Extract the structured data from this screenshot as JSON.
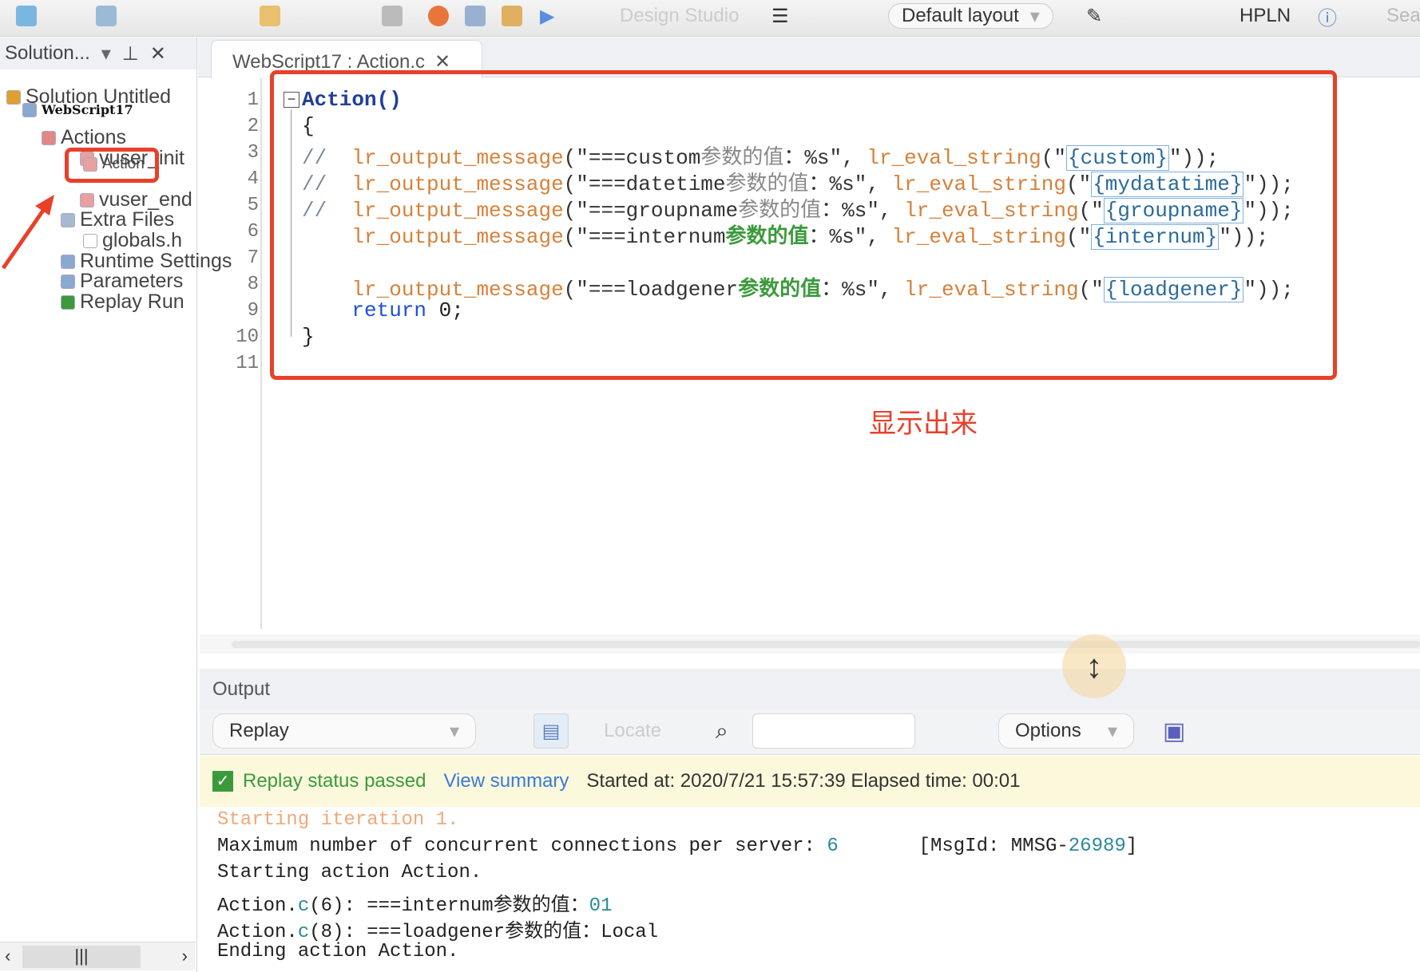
{
  "toolbar": {
    "design_studio": "Design Studio",
    "layout": "Default layout",
    "hpln": "HPLN",
    "search": "Sea"
  },
  "solution": {
    "title": "Solution...",
    "items": [
      {
        "label": "Solution Untitled",
        "icon": "solution-icon"
      },
      {
        "label": "WebScript17",
        "icon": "script-icon"
      },
      {
        "label": "Actions",
        "icon": "actions-icon"
      },
      {
        "label": "vuser_init",
        "icon": "action-icon"
      },
      {
        "label": "Action",
        "icon": "action-icon"
      },
      {
        "label": "vuser_end",
        "icon": "action-icon"
      },
      {
        "label": "Extra Files",
        "icon": "files-icon"
      },
      {
        "label": "globals.h",
        "icon": "file-icon"
      },
      {
        "label": "Runtime Settings",
        "icon": "runtime-icon"
      },
      {
        "label": "Parameters",
        "icon": "parameters-icon"
      },
      {
        "label": "Replay Run",
        "icon": "check-icon"
      }
    ]
  },
  "editor": {
    "tab": "WebScript17 : Action.c",
    "lines": [
      [
        {
          "t": "Action()",
          "c": "fold"
        }
      ],
      [
        {
          "t": "{",
          "c": ""
        }
      ],
      [
        {
          "t": "//  ",
          "c": "cm"
        },
        {
          "t": "lr_output_message",
          "c": "fn"
        },
        {
          "t": "(\"===custom",
          "c": "str"
        },
        {
          "t": "参数的值",
          "c": "zhc"
        },
        {
          "t": "：%s\", ",
          "c": "str"
        },
        {
          "t": "lr_eval_string",
          "c": "fn"
        },
        {
          "t": "(\"",
          "c": "str"
        },
        {
          "t": "{custom}",
          "c": "prm"
        },
        {
          "t": "\"));",
          "c": "str"
        }
      ],
      [
        {
          "t": "//  ",
          "c": "cm"
        },
        {
          "t": "lr_output_message",
          "c": "fn"
        },
        {
          "t": "(\"===datetime",
          "c": "str"
        },
        {
          "t": "参数的值",
          "c": "zhc"
        },
        {
          "t": "：%s\", ",
          "c": "str"
        },
        {
          "t": "lr_eval_string",
          "c": "fn"
        },
        {
          "t": "(\"",
          "c": "str"
        },
        {
          "t": "{mydatatime}",
          "c": "prm"
        },
        {
          "t": "\"));",
          "c": "str"
        }
      ],
      [
        {
          "t": "//  ",
          "c": "cm"
        },
        {
          "t": "lr_output_message",
          "c": "fn"
        },
        {
          "t": "(\"===groupname",
          "c": "str"
        },
        {
          "t": "参数的值",
          "c": "zhc"
        },
        {
          "t": "：%s\", ",
          "c": "str"
        },
        {
          "t": "lr_eval_string",
          "c": "fn"
        },
        {
          "t": "(\"",
          "c": "str"
        },
        {
          "t": "{groupname}",
          "c": "prm"
        },
        {
          "t": "\"));",
          "c": "str"
        }
      ],
      [
        {
          "t": "    ",
          "c": ""
        },
        {
          "t": "lr_output_message",
          "c": "fn"
        },
        {
          "t": "(\"===internum",
          "c": "str"
        },
        {
          "t": "参数的值",
          "c": "zh"
        },
        {
          "t": "：%s\", ",
          "c": "str"
        },
        {
          "t": "lr_eval_string",
          "c": "fn"
        },
        {
          "t": "(\"",
          "c": "str"
        },
        {
          "t": "{internum}",
          "c": "prm"
        },
        {
          "t": "\"));",
          "c": "str"
        }
      ],
      [],
      [
        {
          "t": "    ",
          "c": ""
        },
        {
          "t": "lr_output_message",
          "c": "fn"
        },
        {
          "t": "(\"===loadgener",
          "c": "str"
        },
        {
          "t": "参数的值",
          "c": "zh"
        },
        {
          "t": "：%s\", ",
          "c": "str"
        },
        {
          "t": "lr_eval_string",
          "c": "fn"
        },
        {
          "t": "(\"",
          "c": "str"
        },
        {
          "t": "{loadgener}",
          "c": "prm"
        },
        {
          "t": "\"));",
          "c": "str"
        }
      ],
      [
        {
          "t": "    ",
          "c": ""
        },
        {
          "t": "return",
          "c": "kw"
        },
        {
          "t": " 0;",
          "c": "num"
        }
      ],
      [
        {
          "t": "}",
          "c": ""
        }
      ],
      []
    ]
  },
  "annotation": "显示出来",
  "output": {
    "title": "Output",
    "source": "Replay",
    "locate": "Locate",
    "search_value": "",
    "options": "Options",
    "status": "Replay status passed",
    "view_summary": "View summary",
    "started": "Started at: 2020/7/21 15:57:39 Elapsed time: 00:01",
    "log": [
      [
        {
          "t": "Starting iteration 1.",
          "c": "or"
        }
      ],
      [
        {
          "t": "Maximum number of concurrent connections per server: ",
          "c": ""
        },
        {
          "t": "6",
          "c": "tl"
        },
        {
          "t": "       [MsgId: MMSG-",
          "c": ""
        },
        {
          "t": "26989",
          "c": "tl"
        },
        {
          "t": "]",
          "c": ""
        }
      ],
      [
        {
          "t": "Starting action Action.",
          "c": ""
        }
      ],
      [
        {
          "t": "Action.",
          "c": ""
        },
        {
          "t": "c",
          "c": "tl"
        },
        {
          "t": "(6): ===internum参数的值：",
          "c": ""
        },
        {
          "t": "01",
          "c": "tl"
        }
      ],
      [
        {
          "t": "Action.",
          "c": ""
        },
        {
          "t": "c",
          "c": "tl"
        },
        {
          "t": "(8): ===loadgener参数的值：Local",
          "c": ""
        }
      ],
      [
        {
          "t": "Ending action Action.",
          "c": ""
        }
      ]
    ]
  },
  "colors": {
    "highlight": "#e8402a",
    "status_bg": "#fbf8dc",
    "link": "#3a7ad6",
    "pass": "#3c9a3c"
  }
}
